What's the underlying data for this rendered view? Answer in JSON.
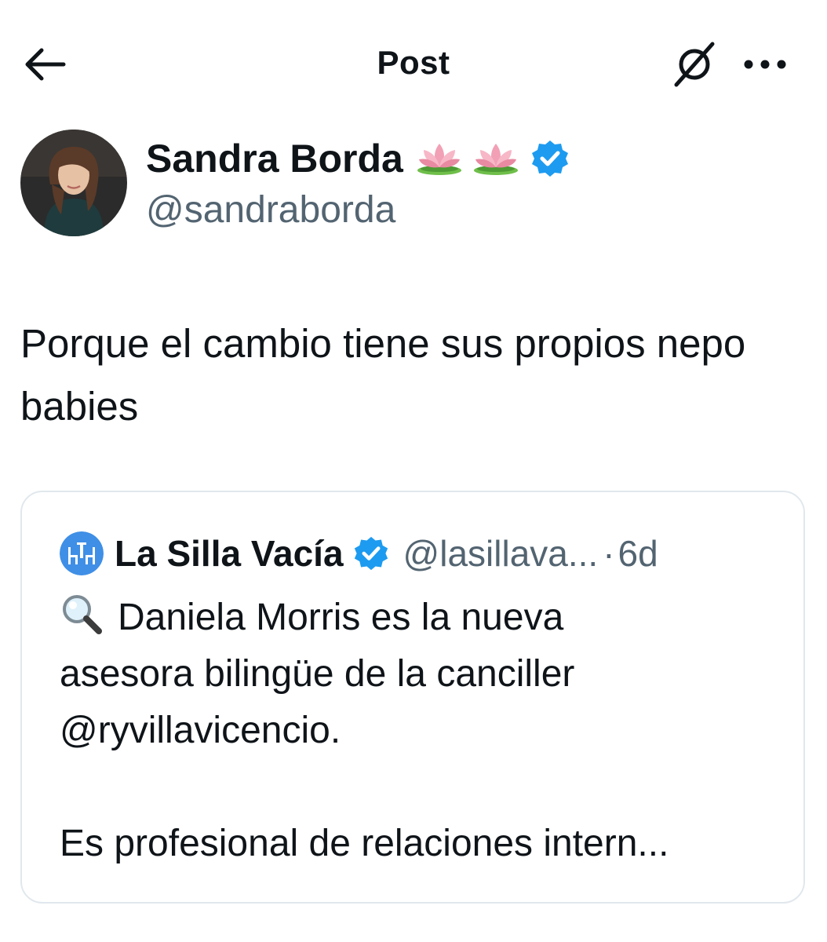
{
  "header": {
    "title": "Post",
    "back_icon": "back-arrow-icon",
    "grok_icon": "grok-icon",
    "more_icon": "more-horizontal-icon"
  },
  "author": {
    "name": "Sandra Borda",
    "emoji_badges": [
      "lotus-icon",
      "lotus-icon"
    ],
    "verified_icon": "verified-badge-icon",
    "handle": "@sandraborda"
  },
  "post": {
    "text": "Porque el cambio tiene sus propios nepo babies"
  },
  "quote": {
    "name": "La Silla Vacía",
    "verified_icon": "verified-badge-icon",
    "handle": "@lasillava...",
    "separator": "·",
    "time": "6d",
    "lines": [
      "Daniela Morris es la nueva",
      "asesora bilingüe de la canciller",
      "@ryvillavicencio.",
      "",
      "Es profesional de relaciones intern..."
    ]
  },
  "colors": {
    "text_primary": "#0f1419",
    "text_secondary": "#536471",
    "verified_blue": "#1d9bf0",
    "border": "#e1e8ed",
    "background": "#ffffff"
  }
}
